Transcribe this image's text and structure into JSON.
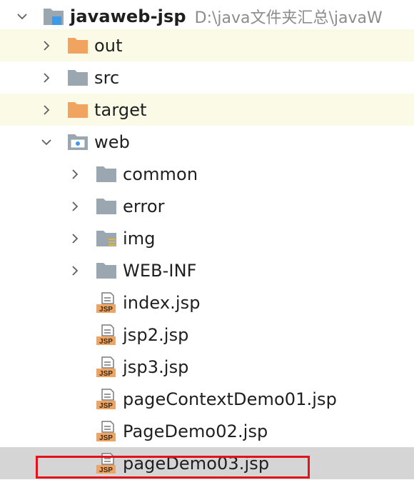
{
  "project": {
    "name": "javaweb-jsp",
    "path": "D:\\java文件夹汇总\\javaW"
  },
  "tree": {
    "out": "out",
    "src": "src",
    "target": "target",
    "web": "web",
    "common": "common",
    "error": "error",
    "img": "img",
    "web_inf": "WEB-INF",
    "files": [
      "index.jsp",
      "jsp2.jsp",
      "jsp3.jsp",
      "pageContextDemo01.jsp",
      "PageDemo02.jsp",
      "pageDemo03.jsp"
    ],
    "jsp_badge": "JSP"
  },
  "colors": {
    "excluded_folder": "#f0a45f",
    "folder": "#9aa7b0",
    "module_blue": "#3d9ae8",
    "highlight": "#e3131b",
    "selected_row": "#d5d5d5",
    "excluded_row": "#fbfae7"
  },
  "icons": {
    "module": "module-folder-icon",
    "folder": "folder-icon",
    "excluded": "excluded-folder-icon",
    "web": "web-folder-icon",
    "resource": "resource-folder-icon",
    "jsp": "jsp-file-icon",
    "expanded": "chevron-down-icon",
    "collapsed": "chevron-right-icon"
  }
}
